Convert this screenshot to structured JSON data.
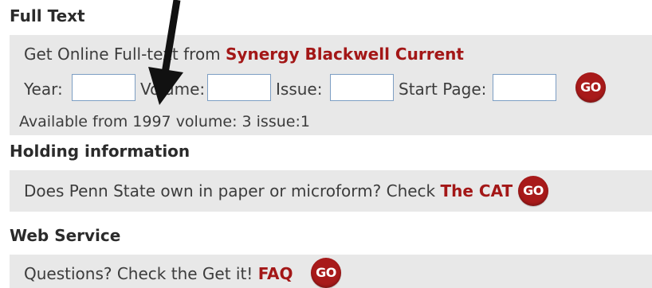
{
  "colors": {
    "panel_bg": "#e8e8e8",
    "link": "#a31717",
    "go_button": "#a81a1a",
    "input_border": "#7d9ec3",
    "annotation_arrow": "#111111"
  },
  "full_text": {
    "header": "Full Text",
    "intro_prefix": "Get Online Full-text from ",
    "source_link": "Synergy Blackwell Current",
    "fields": {
      "year_label": "Year:",
      "year_value": "",
      "volume_label": "Volume:",
      "volume_value": "",
      "issue_label": "Issue:",
      "issue_value": "",
      "start_page_label": "Start Page:",
      "start_page_value": ""
    },
    "go_label": "GO",
    "availability": "Available from 1997 volume: 3 issue:1"
  },
  "holding": {
    "header": "Holding information",
    "question_prefix": "Does Penn State own in paper or microform? Check ",
    "catalog_link": "The CAT",
    "go_label": "GO"
  },
  "web_service": {
    "header": "Web Service",
    "question_prefix": "Questions? Check the Get it! ",
    "faq_link": "FAQ",
    "go_label": "GO"
  },
  "annotation": {
    "icon": "down-arrow-icon"
  }
}
